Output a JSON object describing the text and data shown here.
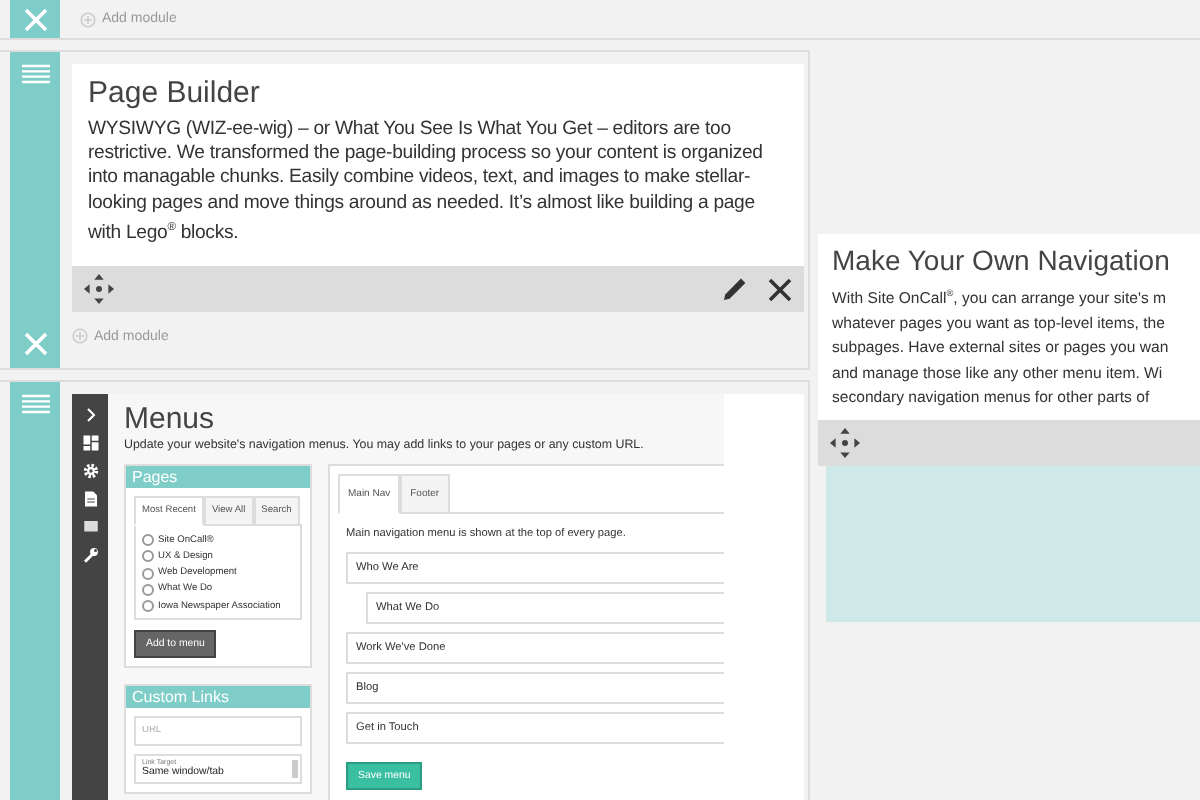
{
  "top_module": {
    "add_label": "Add module"
  },
  "page_builder": {
    "title": "Page Builder",
    "body": "WYSIWYG (WIZ-ee-wig) – or What You See Is What You Get – editors are too restrictive. We transformed the page-building process so your content is organized into managable chunks. Easily combine videos, text, and images to make stellar-looking pages and move things around as needed. It’s almost like building a page with Lego$^{®}$ blocks.",
    "add_label": "Add module"
  },
  "navigation_card": {
    "title": "Make Your Own Navigation",
    "lines": [
      "With Site OnCall$^{®}$, you can arrange your site's m",
      "whatever pages you want as top-level items, the",
      "subpages. Have external sites or pages you wan",
      "and manage those like any other menu item. Wi",
      "secondary navigation menus for other parts of"
    ]
  },
  "menus_screen": {
    "title": "Menus",
    "description": "Update your website's navigation menus. You may add links to your pages or any custom URL.",
    "pages_panel": {
      "title": "Pages",
      "tabs": [
        {
          "label": "Most Recent",
          "selected": true
        },
        {
          "label": "View All",
          "selected": false
        },
        {
          "label": "Search",
          "selected": false
        }
      ],
      "pages": [
        {
          "label": "Site OnCall®",
          "checked": false
        },
        {
          "label": "UX & Design",
          "checked": false
        },
        {
          "label": "Web Development",
          "checked": false
        },
        {
          "label": "What We Do",
          "checked": false
        },
        {
          "label": "Iowa Newspaper Association",
          "checked": false
        }
      ],
      "button": "Add to menu"
    },
    "custom_links": {
      "title": "Custom Links",
      "url_placeholder": "URL",
      "target_label": "Link Target",
      "target_value": "Same window/tab"
    },
    "nav_panel": {
      "tabs": [
        {
          "label": "Main Nav",
          "selected": true
        },
        {
          "label": "Footer",
          "selected": false
        }
      ],
      "description": "Main navigation menu is shown at the top of every page.",
      "items": [
        {
          "label": "Who We Are",
          "children": [
            {
              "label": "What We Do"
            }
          ]
        },
        {
          "label": "Work We've Done"
        },
        {
          "label": "Blog"
        },
        {
          "label": "Get in Touch"
        }
      ],
      "button": "Save menu"
    }
  }
}
